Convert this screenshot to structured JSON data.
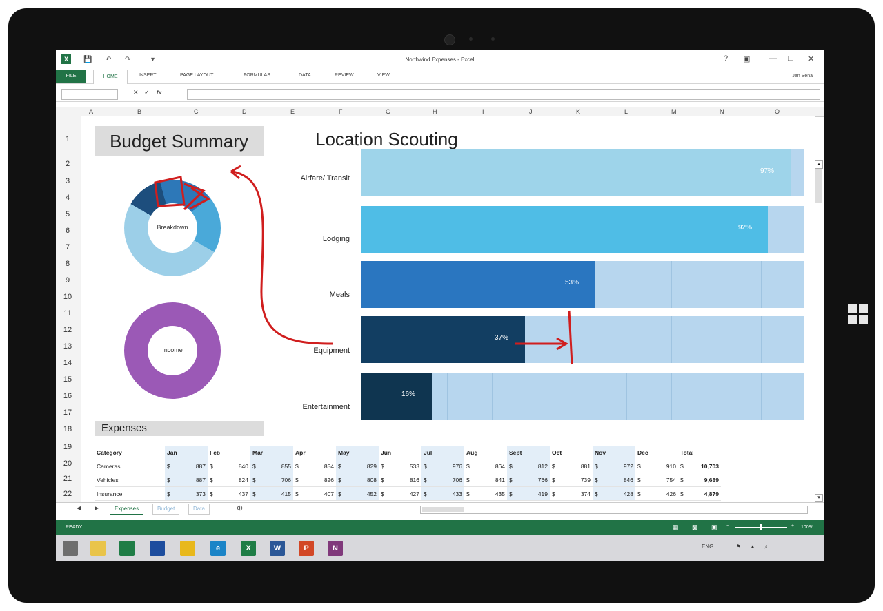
{
  "app": {
    "title": "Northwind Expenses - Excel",
    "logo_letter": "X",
    "user": "Jen Sena"
  },
  "ribbon": {
    "tabs": [
      "FILE",
      "HOME",
      "INSERT",
      "PAGE LAYOUT",
      "FORMULAS",
      "DATA",
      "REVIEW",
      "VIEW"
    ]
  },
  "formula_bar": {
    "fx": "fx",
    "name_box": "",
    "formula": ""
  },
  "columns": [
    "A",
    "B",
    "C",
    "D",
    "E",
    "F",
    "G",
    "H",
    "I",
    "J",
    "K",
    "L",
    "M",
    "N",
    "O"
  ],
  "rows": [
    "1",
    "2",
    "3",
    "4",
    "5",
    "6",
    "7",
    "8",
    "9",
    "10",
    "11",
    "12",
    "13",
    "14",
    "15",
    "16",
    "17",
    "18",
    "19",
    "20",
    "21",
    "22"
  ],
  "budget_summary": {
    "title": "Budget Summary",
    "donut1_label": "Breakdown",
    "donut2_label": "Income",
    "colors": {
      "dark": "#1d4e7d",
      "mid": "#2d78b8",
      "light": "#9ccfe8",
      "accent": "#4aa9d9",
      "income": "#9b59b6"
    }
  },
  "location_scouting": {
    "title": "Location Scouting",
    "bars": [
      {
        "label": "Airfare/ Transit",
        "value": 97,
        "pct_label": "97%",
        "color": "#9ed4ea"
      },
      {
        "label": "Lodging",
        "value": 92,
        "pct_label": "92%",
        "color": "#4fbde6"
      },
      {
        "label": "Meals",
        "value": 53,
        "pct_label": "53%",
        "color": "#2a76c0"
      },
      {
        "label": "Equipment",
        "value": 37,
        "pct_label": "37%",
        "color": "#123e62"
      },
      {
        "label": "Entertainment",
        "value": 16,
        "pct_label": "16%",
        "color": "#0f3550"
      }
    ],
    "track_color": "#b7d6ee"
  },
  "expenses": {
    "title": "Expenses",
    "headers": [
      "Category",
      "Jan",
      "Feb",
      "Mar",
      "Apr",
      "May",
      "Jun",
      "Jul",
      "Aug",
      "Sept",
      "Oct",
      "Nov",
      "Dec",
      "Total"
    ],
    "currency": "$",
    "rows": [
      {
        "category": "Cameras",
        "values": [
          "887",
          "840",
          "855",
          "854",
          "829",
          "533",
          "976",
          "864",
          "812",
          "881",
          "972",
          "910"
        ],
        "total": "10,703"
      },
      {
        "category": "Vehicles",
        "values": [
          "887",
          "824",
          "706",
          "826",
          "808",
          "816",
          "706",
          "841",
          "766",
          "739",
          "846",
          "754"
        ],
        "total": "9,689"
      },
      {
        "category": "Insurance",
        "values": [
          "373",
          "437",
          "415",
          "407",
          "452",
          "427",
          "433",
          "435",
          "419",
          "374",
          "428",
          "426"
        ],
        "total": "4,879"
      }
    ]
  },
  "sheet_tabs": [
    "Expenses",
    "Budget",
    "Data"
  ],
  "status": {
    "ready": "READY",
    "zoom": "100%"
  },
  "taskbar": {
    "apps": [
      {
        "name": "Start",
        "color": "#6e6e6e",
        "glyph": ""
      },
      {
        "name": "File Explorer",
        "color": "#e9c44a",
        "glyph": ""
      },
      {
        "name": "Store",
        "color": "#1f7d46",
        "glyph": ""
      },
      {
        "name": "Outlook",
        "color": "#1e4d9e",
        "glyph": ""
      },
      {
        "name": "Photos",
        "color": "#e8b81c",
        "glyph": ""
      },
      {
        "name": "Internet Explorer",
        "color": "#1b84c7",
        "glyph": "e"
      },
      {
        "name": "Excel",
        "color": "#1f7d46",
        "glyph": "X"
      },
      {
        "name": "Word",
        "color": "#2b5797",
        "glyph": "W"
      },
      {
        "name": "PowerPoint",
        "color": "#d24726",
        "glyph": "P"
      },
      {
        "name": "OneNote",
        "color": "#80397b",
        "glyph": "N"
      }
    ],
    "lang": "ENG"
  }
}
